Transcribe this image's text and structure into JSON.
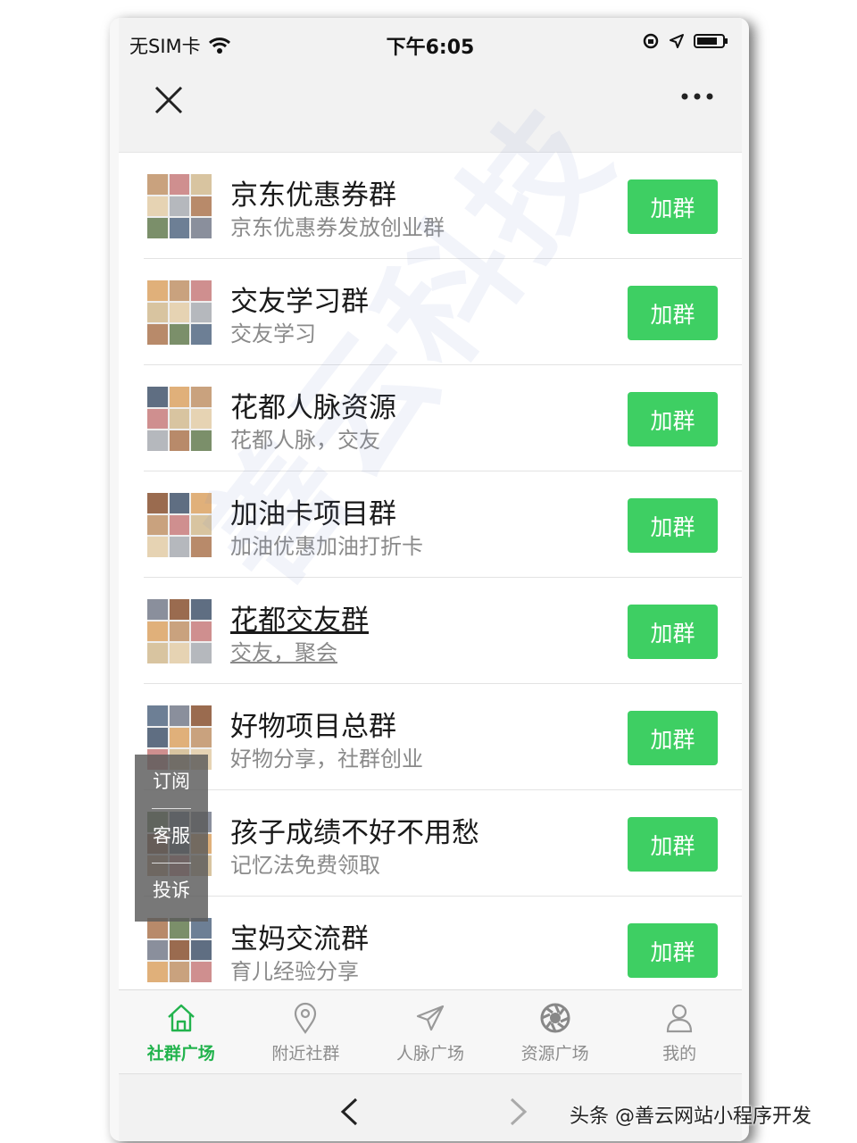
{
  "status": {
    "carrier": "无SIM卡",
    "time": "下午6:05"
  },
  "groups": [
    {
      "name": "京东优惠券群",
      "desc": "京东优惠券发放创业群",
      "join_label": "加群"
    },
    {
      "name": "交友学习群",
      "desc": "交友学习",
      "join_label": "加群"
    },
    {
      "name": "花都人脉资源",
      "desc": "花都人脉，交友",
      "join_label": "加群"
    },
    {
      "name": "加油卡项目群",
      "desc": "加油优惠加油打折卡",
      "join_label": "加群"
    },
    {
      "name": "花都交友群",
      "desc": "交友，聚会",
      "join_label": "加群"
    },
    {
      "name": "好物项目总群",
      "desc": "好物分享，社群创业",
      "join_label": "加群"
    },
    {
      "name": "孩子成绩不好不用愁",
      "desc": "记忆法免费领取",
      "join_label": "加群"
    },
    {
      "name": "宝妈交流群",
      "desc": "育儿经验分享",
      "join_label": "加群"
    }
  ],
  "float_menu": {
    "subscribe": "订阅",
    "service": "客服",
    "complain": "投诉"
  },
  "watermark": "善云科技",
  "tabs": [
    {
      "label": "社群广场",
      "icon": "home-icon",
      "active": true
    },
    {
      "label": "附近社群",
      "icon": "location-pin-icon"
    },
    {
      "label": "人脉广场",
      "icon": "send-icon"
    },
    {
      "label": "资源广场",
      "icon": "aperture-icon"
    },
    {
      "label": "我的",
      "icon": "user-icon"
    }
  ],
  "credit": "头条 @善云网站小程序开发",
  "colors": {
    "accent": "#3ecf63",
    "tab_active": "#22b34d"
  }
}
